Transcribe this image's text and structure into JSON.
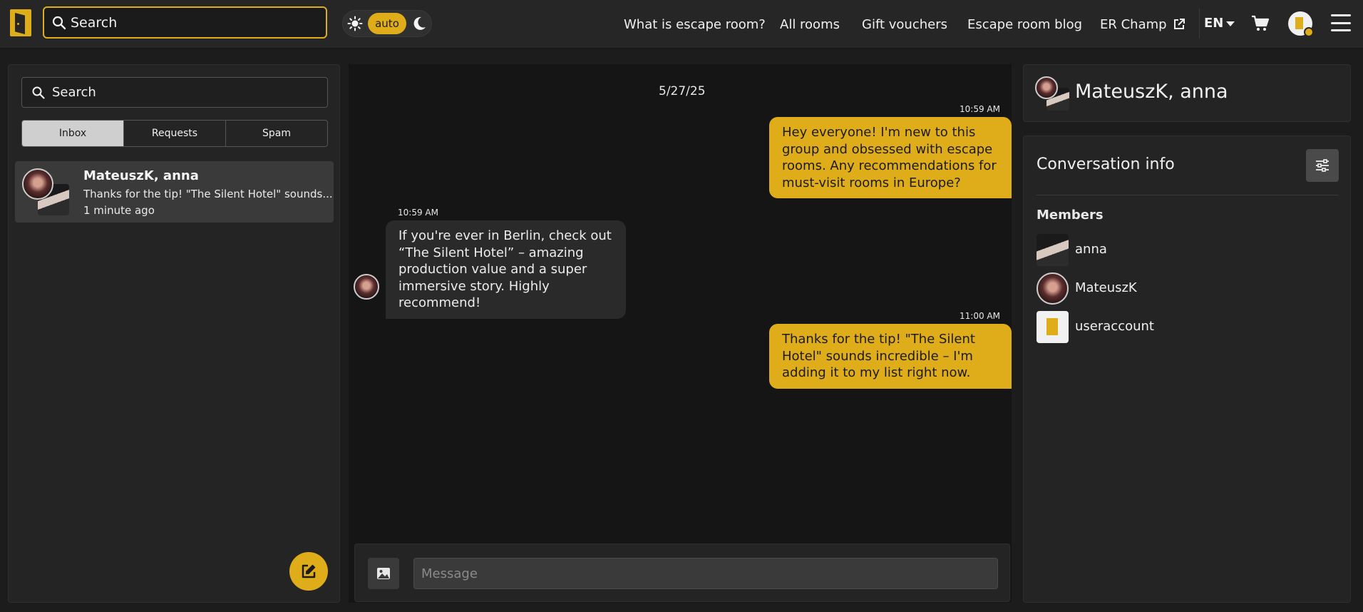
{
  "header": {
    "search_placeholder": "Search",
    "theme_mode": "auto",
    "nav": [
      "What is escape room?",
      "All rooms",
      "Gift vouchers",
      "Escape room blog",
      "ER Champ"
    ],
    "language": "EN"
  },
  "sidebar": {
    "search_placeholder": "Search",
    "tabs": [
      "Inbox",
      "Requests",
      "Spam"
    ],
    "active_tab": "Inbox",
    "conversation": {
      "name": "MateuszK, anna",
      "preview": "Thanks for the tip! \"The Silent Hotel\" sounds...",
      "time": "1 minute ago"
    }
  },
  "chat": {
    "date": "5/27/25",
    "messages": [
      {
        "direction": "out",
        "time": "10:59 AM",
        "text": "Hey everyone! I'm new to this group and obsessed with escape rooms. Any recommendations for must-visit rooms in Europe?"
      },
      {
        "direction": "in",
        "time": "10:59 AM",
        "text": "If you're ever in Berlin, check out “The Silent Hotel” – amazing production value and a super immersive story. Highly recommend!"
      },
      {
        "direction": "out",
        "time": "11:00 AM",
        "text": "Thanks for the tip! \"The Silent Hotel\" sounds incredible – I'm adding it to my list right now."
      }
    ],
    "composer_placeholder": "Message"
  },
  "info": {
    "conversation_title": "MateuszK, anna",
    "title": "Conversation info",
    "members_label": "Members",
    "members": [
      "anna",
      "MateuszK",
      "useraccount"
    ]
  },
  "colors": {
    "accent": "#e0ad1a",
    "background": "#151515",
    "panel": "#242424",
    "topbar": "#262626"
  }
}
